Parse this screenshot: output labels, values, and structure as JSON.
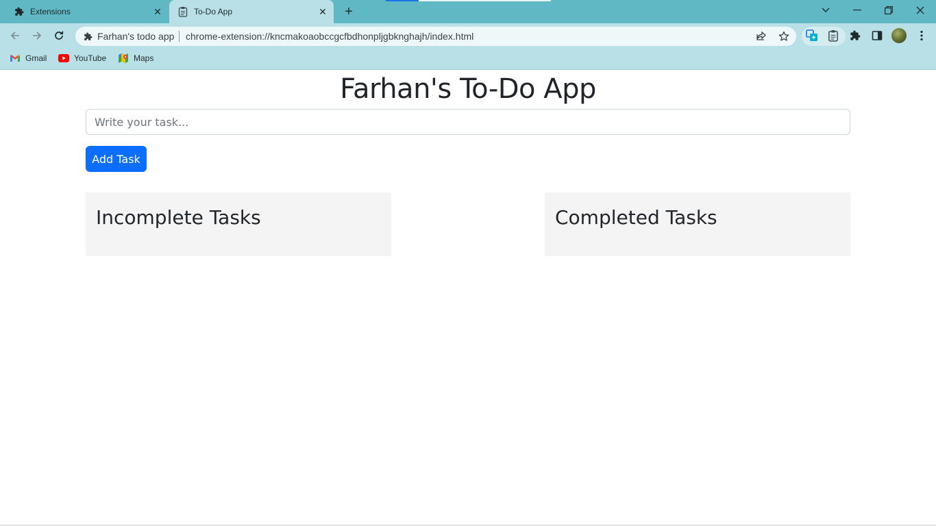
{
  "browser": {
    "tabs": [
      {
        "title": "Extensions",
        "icon": "puzzle-icon",
        "active": false
      },
      {
        "title": "To-Do App",
        "icon": "clipboard-icon",
        "active": true
      }
    ],
    "address_bar": {
      "site_name": "Farhan's todo app",
      "url": "chrome-extension://kncmakoaobccgcfbdhonpljgbknghajh/index.html"
    },
    "bookmarks": [
      {
        "label": "Gmail",
        "icon": "gmail-icon"
      },
      {
        "label": "YouTube",
        "icon": "youtube-icon"
      },
      {
        "label": "Maps",
        "icon": "maps-icon"
      }
    ]
  },
  "app": {
    "title": "Farhan's To-Do App",
    "input_placeholder": "Write your task...",
    "input_value": "",
    "add_button_label": "Add Task",
    "incomplete_heading": "Incomplete Tasks",
    "completed_heading": "Completed Tasks",
    "incomplete_tasks": [],
    "completed_tasks": []
  },
  "colors": {
    "tabstrip": "#5fb8c4",
    "toolbar": "#b8e0e6",
    "primary_button": "#0d6efd",
    "panel_background": "#f4f4f4"
  }
}
